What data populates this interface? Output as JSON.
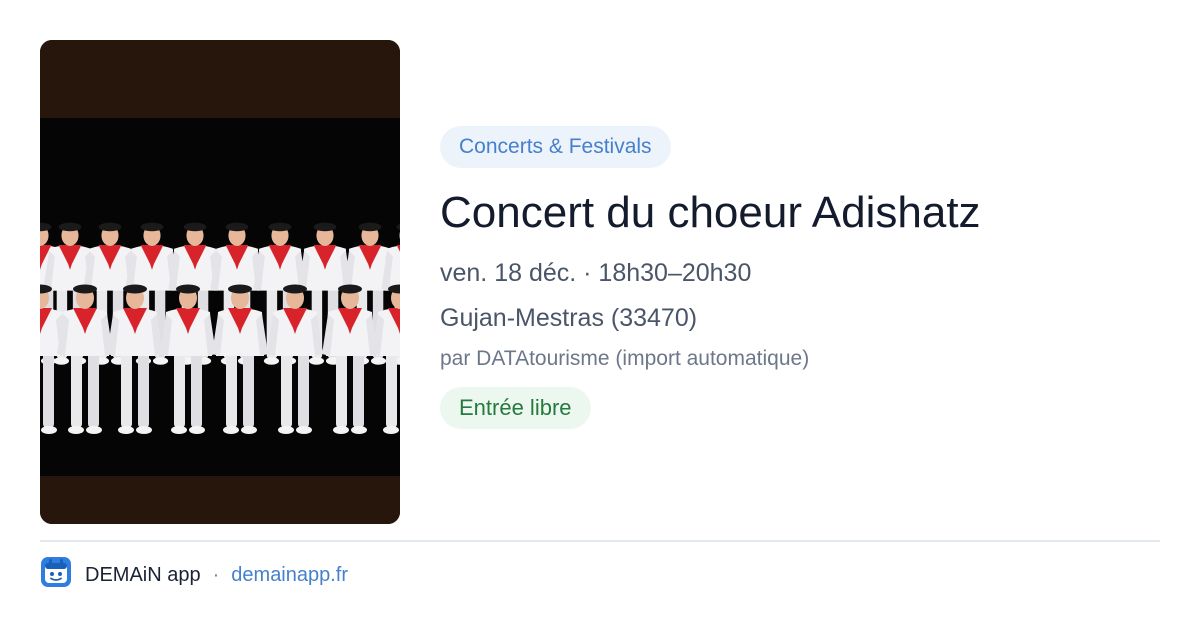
{
  "event": {
    "image_alt": "Choeur Adishatz en tenue blanche avec foulards rouges",
    "category": "Concerts & Festivals",
    "title": "Concert du choeur Adishatz",
    "datetime": "ven. 18 déc. · 18h30–20h30",
    "location": "Gujan-Mestras (33470)",
    "source": "par DATAtourisme (import automatique)",
    "price": "Entrée libre"
  },
  "footer": {
    "app_name": "DEMAiN app",
    "separator": "·",
    "site": "demainapp.fr",
    "logo_icon": "demain-app-logo-icon"
  },
  "colors": {
    "image_band": "#26160c",
    "category_bg": "#edf3fb",
    "category_text": "#4580cc",
    "price_bg": "#ecf8ef",
    "price_text": "#267a3e",
    "link": "#4680cc",
    "logo_blue": "#2f7de1"
  }
}
